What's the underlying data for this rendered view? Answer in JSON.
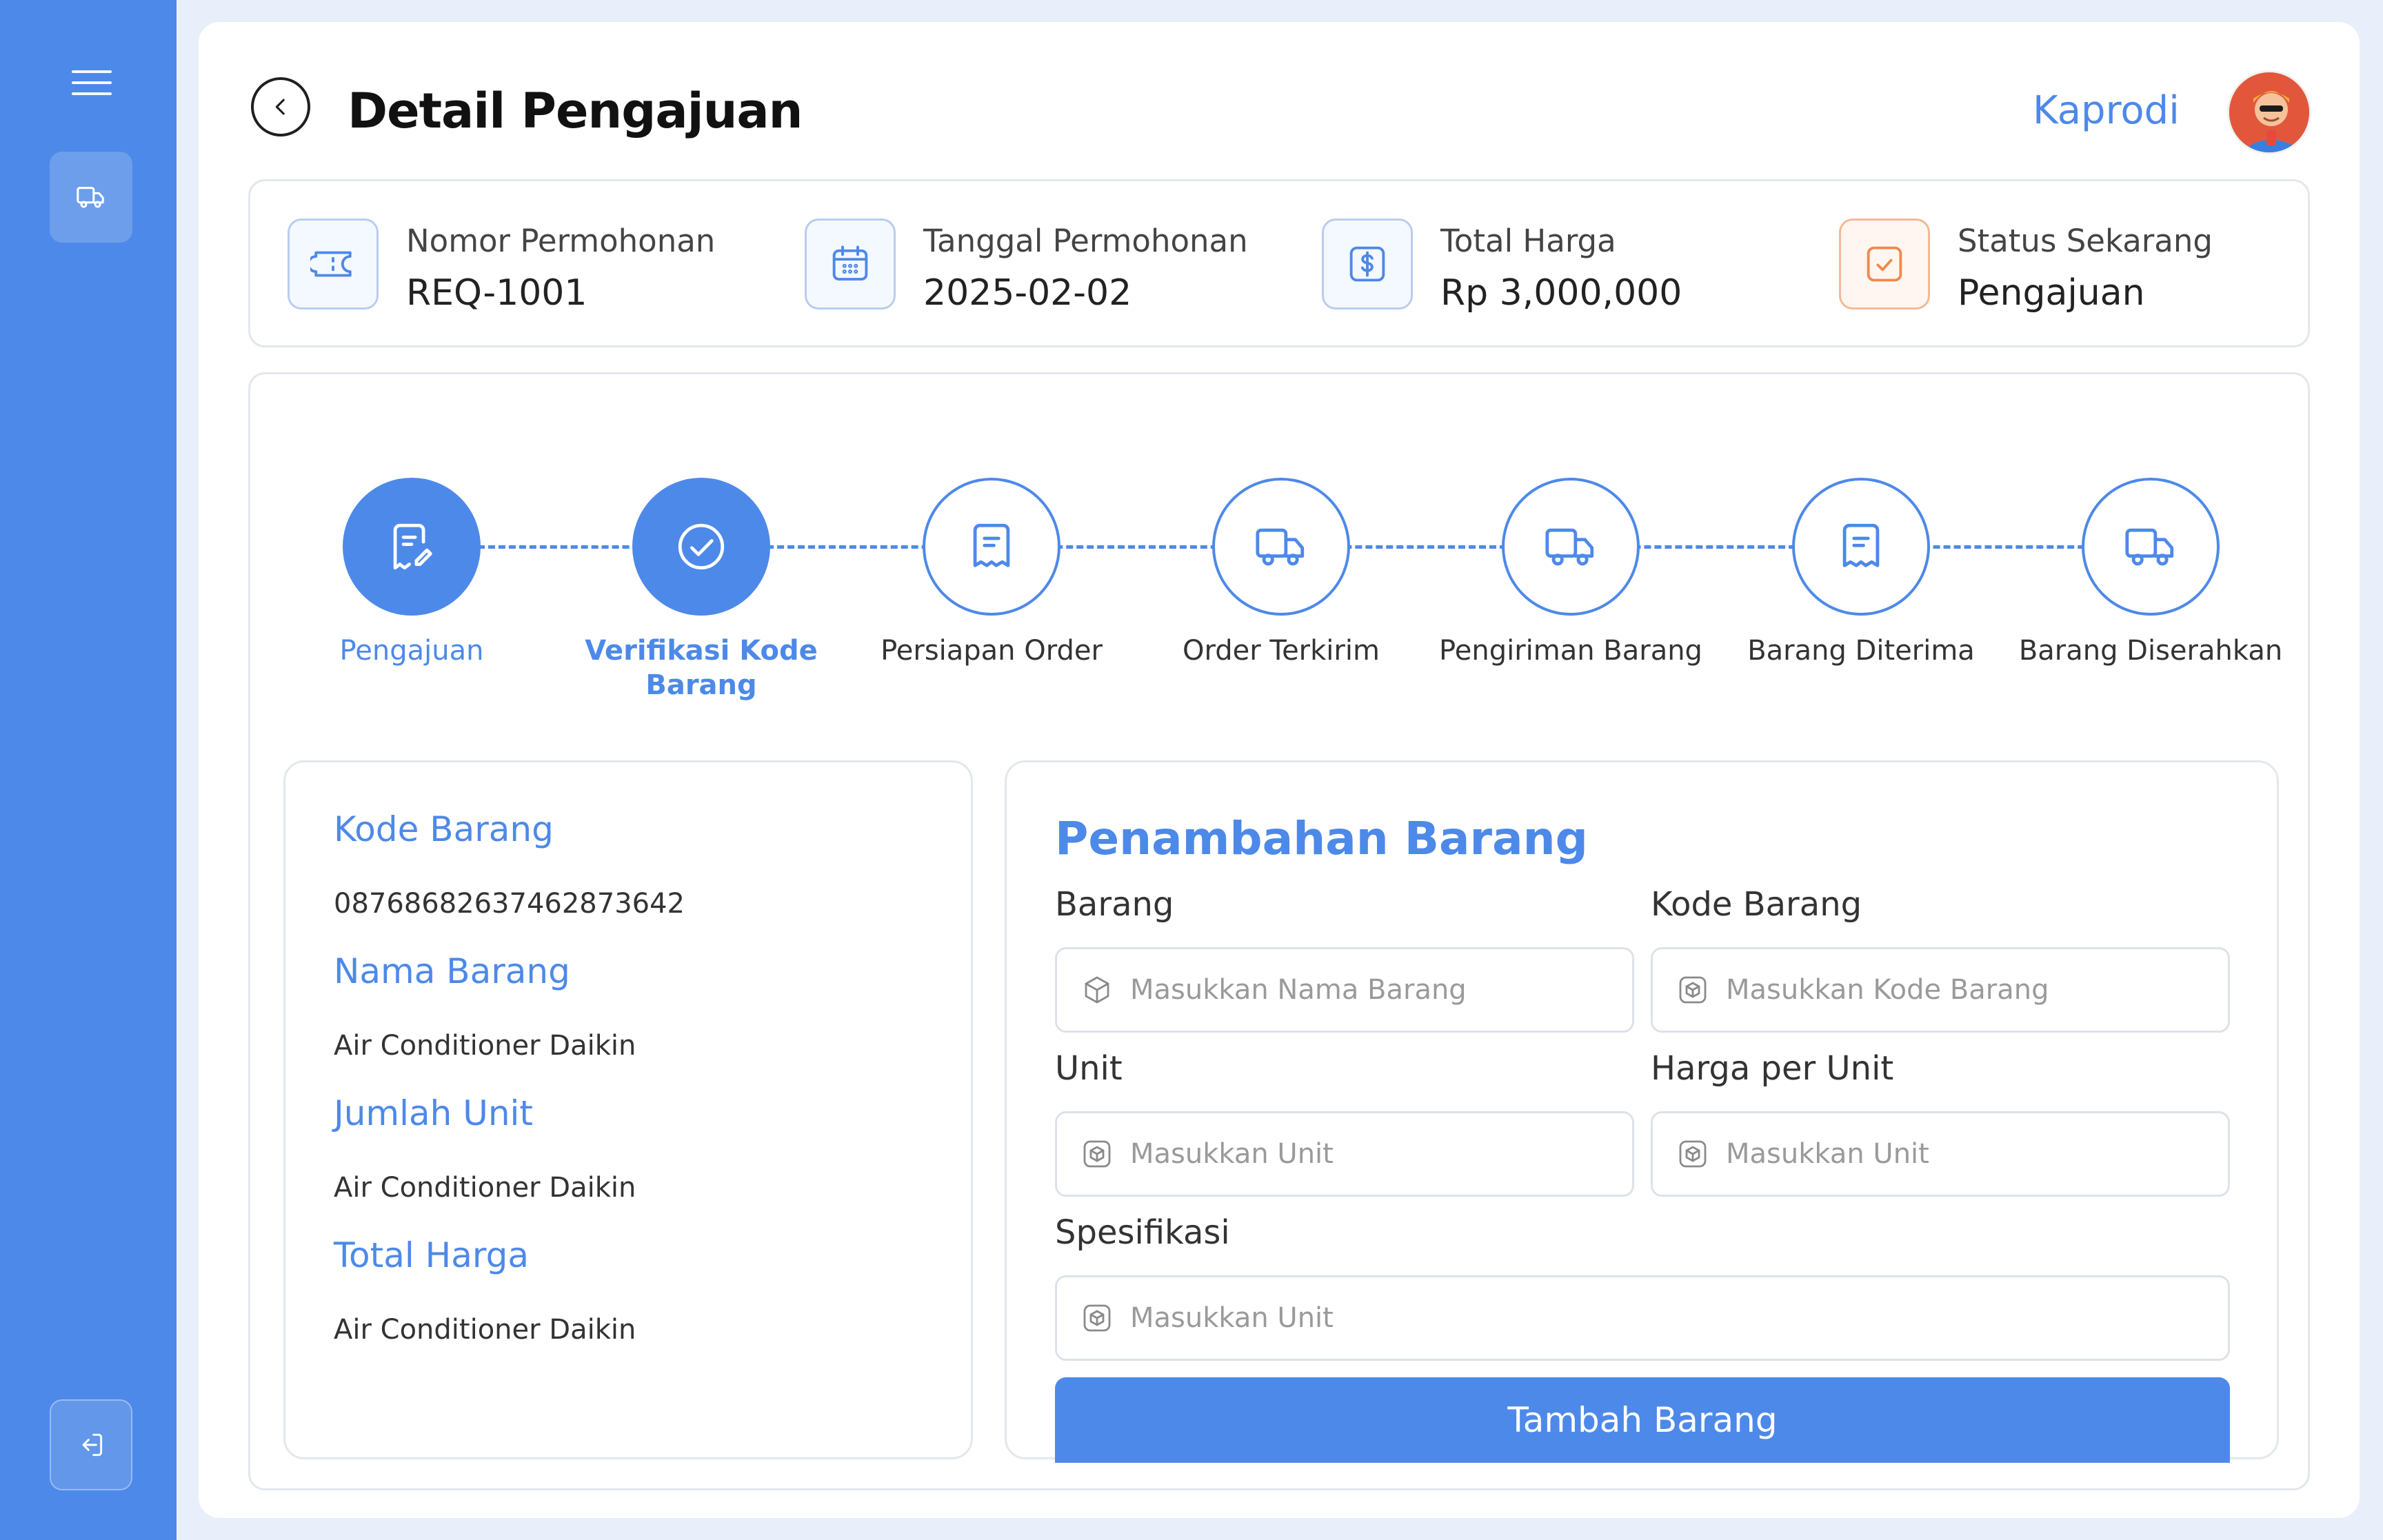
{
  "header": {
    "title": "Detail Pengajuan",
    "role": "Kaprodi"
  },
  "info": [
    {
      "label": "Nomor Permohonan",
      "value": "REQ-1001",
      "icon": "ticket-icon"
    },
    {
      "label": "Tanggal Permohonan",
      "value": "2025-02-02",
      "icon": "calendar-icon"
    },
    {
      "label": "Total Harga",
      "value": "Rp 3,000,000",
      "icon": "dollar-icon"
    },
    {
      "label": "Status Sekarang",
      "value": "Pengajuan",
      "icon": "check-icon"
    }
  ],
  "steps": [
    {
      "label": "Pengajuan",
      "status": "done"
    },
    {
      "label": "Verifikasi Kode Barang",
      "status": "active"
    },
    {
      "label": "Persiapan Order",
      "status": "pending"
    },
    {
      "label": "Order Terkirim",
      "status": "pending"
    },
    {
      "label": "Pengiriman Barang",
      "status": "pending"
    },
    {
      "label": "Barang Diterima",
      "status": "pending"
    },
    {
      "label": "Barang Diserahkan",
      "status": "pending"
    }
  ],
  "detail": {
    "kode_label": "Kode Barang",
    "kode_value": "08768682637462873642",
    "nama_label": "Nama Barang",
    "nama_value": "Air Conditioner Daikin",
    "jumlah_label": "Jumlah Unit",
    "jumlah_value": "Air Conditioner Daikin",
    "total_label": "Total Harga",
    "total_value": "Air Conditioner Daikin"
  },
  "form": {
    "title": "Penambahan Barang",
    "barang_label": "Barang",
    "barang_placeholder": "Masukkan Nama Barang",
    "kode_label": "Kode Barang",
    "kode_placeholder": "Masukkan Kode Barang",
    "unit_label": "Unit",
    "unit_placeholder": "Masukkan Unit",
    "harga_label": "Harga per Unit",
    "harga_placeholder": "Masukkan Unit",
    "spesifikasi_label": "Spesifikasi",
    "spesifikasi_placeholder": "Masukkan Unit",
    "submit_label": "Tambah Barang"
  },
  "colors": {
    "accent": "#4d89e8",
    "status_orange": "#f08a4b"
  }
}
